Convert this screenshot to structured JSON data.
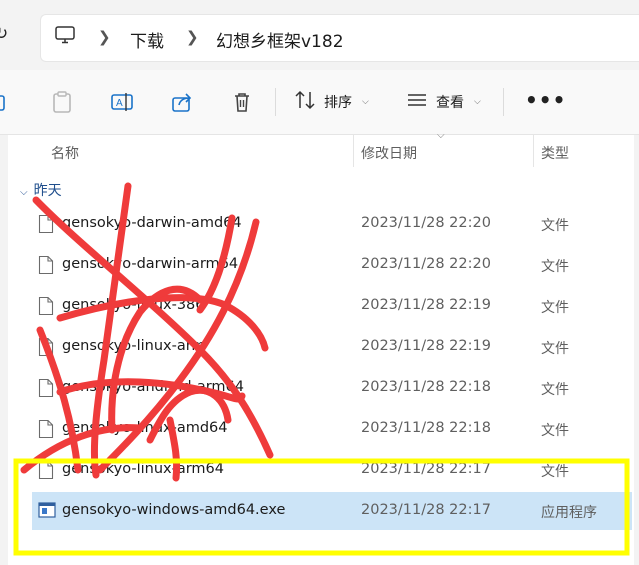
{
  "address": {
    "crumbs": [
      "下载",
      "幻想乡框架v182"
    ]
  },
  "toolbar": {
    "sort_label": "排序",
    "view_label": "查看"
  },
  "columns": {
    "name": "名称",
    "modified": "修改日期",
    "type": "类型"
  },
  "group": {
    "label": "昨天"
  },
  "files": [
    {
      "name": "gensokyo-darwin-amd64",
      "date": "2023/11/28 22:20",
      "type": "文件",
      "icon": "file-icon"
    },
    {
      "name": "gensokyo-darwin-arm64",
      "date": "2023/11/28 22:20",
      "type": "文件",
      "icon": "file-icon"
    },
    {
      "name": "gensokyo-linux-386",
      "date": "2023/11/28 22:19",
      "type": "文件",
      "icon": "file-icon"
    },
    {
      "name": "gensokyo-linux-arm",
      "date": "2023/11/28 22:19",
      "type": "文件",
      "icon": "file-icon"
    },
    {
      "name": "gensokyo-android-arm64",
      "date": "2023/11/28 22:18",
      "type": "文件",
      "icon": "file-icon"
    },
    {
      "name": "gensokyo-linux-amd64",
      "date": "2023/11/28 22:18",
      "type": "文件",
      "icon": "file-icon"
    },
    {
      "name": "gensokyo-linux-arm64",
      "date": "2023/11/28 22:17",
      "type": "文件",
      "icon": "file-icon"
    },
    {
      "name": "gensokyo-windows-amd64.exe",
      "date": "2023/11/28 22:17",
      "type": "应用程序",
      "icon": "application-icon",
      "selected": true
    }
  ],
  "colors": {
    "selection": "#cce4f7",
    "scribble": "#ef3b3b",
    "highlight_box": "#ffff00",
    "group_text": "#1f4e8c"
  }
}
